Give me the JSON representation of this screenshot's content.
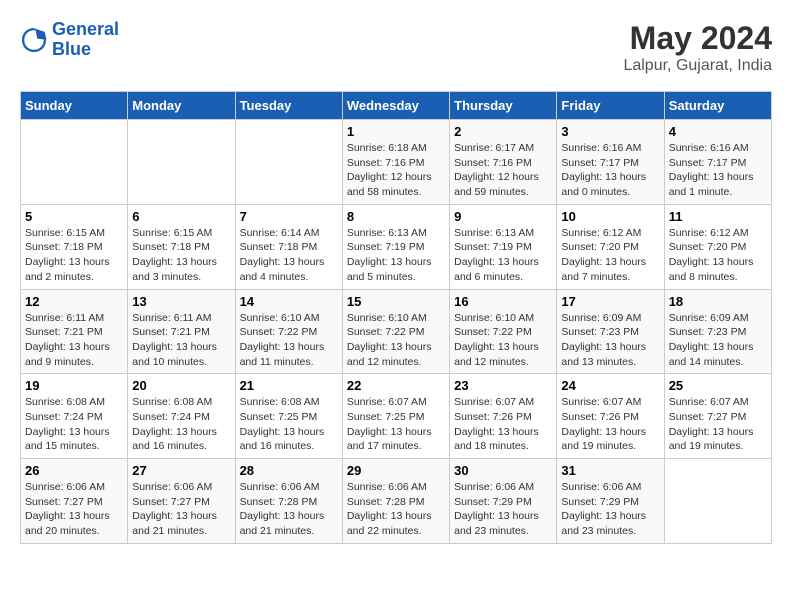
{
  "header": {
    "logo_line1": "General",
    "logo_line2": "Blue",
    "month_year": "May 2024",
    "location": "Lalpur, Gujarat, India"
  },
  "days_of_week": [
    "Sunday",
    "Monday",
    "Tuesday",
    "Wednesday",
    "Thursday",
    "Friday",
    "Saturday"
  ],
  "weeks": [
    [
      {
        "day": "",
        "info": ""
      },
      {
        "day": "",
        "info": ""
      },
      {
        "day": "",
        "info": ""
      },
      {
        "day": "1",
        "info": "Sunrise: 6:18 AM\nSunset: 7:16 PM\nDaylight: 12 hours\nand 58 minutes."
      },
      {
        "day": "2",
        "info": "Sunrise: 6:17 AM\nSunset: 7:16 PM\nDaylight: 12 hours\nand 59 minutes."
      },
      {
        "day": "3",
        "info": "Sunrise: 6:16 AM\nSunset: 7:17 PM\nDaylight: 13 hours\nand 0 minutes."
      },
      {
        "day": "4",
        "info": "Sunrise: 6:16 AM\nSunset: 7:17 PM\nDaylight: 13 hours\nand 1 minute."
      }
    ],
    [
      {
        "day": "5",
        "info": "Sunrise: 6:15 AM\nSunset: 7:18 PM\nDaylight: 13 hours\nand 2 minutes."
      },
      {
        "day": "6",
        "info": "Sunrise: 6:15 AM\nSunset: 7:18 PM\nDaylight: 13 hours\nand 3 minutes."
      },
      {
        "day": "7",
        "info": "Sunrise: 6:14 AM\nSunset: 7:18 PM\nDaylight: 13 hours\nand 4 minutes."
      },
      {
        "day": "8",
        "info": "Sunrise: 6:13 AM\nSunset: 7:19 PM\nDaylight: 13 hours\nand 5 minutes."
      },
      {
        "day": "9",
        "info": "Sunrise: 6:13 AM\nSunset: 7:19 PM\nDaylight: 13 hours\nand 6 minutes."
      },
      {
        "day": "10",
        "info": "Sunrise: 6:12 AM\nSunset: 7:20 PM\nDaylight: 13 hours\nand 7 minutes."
      },
      {
        "day": "11",
        "info": "Sunrise: 6:12 AM\nSunset: 7:20 PM\nDaylight: 13 hours\nand 8 minutes."
      }
    ],
    [
      {
        "day": "12",
        "info": "Sunrise: 6:11 AM\nSunset: 7:21 PM\nDaylight: 13 hours\nand 9 minutes."
      },
      {
        "day": "13",
        "info": "Sunrise: 6:11 AM\nSunset: 7:21 PM\nDaylight: 13 hours\nand 10 minutes."
      },
      {
        "day": "14",
        "info": "Sunrise: 6:10 AM\nSunset: 7:22 PM\nDaylight: 13 hours\nand 11 minutes."
      },
      {
        "day": "15",
        "info": "Sunrise: 6:10 AM\nSunset: 7:22 PM\nDaylight: 13 hours\nand 12 minutes."
      },
      {
        "day": "16",
        "info": "Sunrise: 6:10 AM\nSunset: 7:22 PM\nDaylight: 13 hours\nand 12 minutes."
      },
      {
        "day": "17",
        "info": "Sunrise: 6:09 AM\nSunset: 7:23 PM\nDaylight: 13 hours\nand 13 minutes."
      },
      {
        "day": "18",
        "info": "Sunrise: 6:09 AM\nSunset: 7:23 PM\nDaylight: 13 hours\nand 14 minutes."
      }
    ],
    [
      {
        "day": "19",
        "info": "Sunrise: 6:08 AM\nSunset: 7:24 PM\nDaylight: 13 hours\nand 15 minutes."
      },
      {
        "day": "20",
        "info": "Sunrise: 6:08 AM\nSunset: 7:24 PM\nDaylight: 13 hours\nand 16 minutes."
      },
      {
        "day": "21",
        "info": "Sunrise: 6:08 AM\nSunset: 7:25 PM\nDaylight: 13 hours\nand 16 minutes."
      },
      {
        "day": "22",
        "info": "Sunrise: 6:07 AM\nSunset: 7:25 PM\nDaylight: 13 hours\nand 17 minutes."
      },
      {
        "day": "23",
        "info": "Sunrise: 6:07 AM\nSunset: 7:26 PM\nDaylight: 13 hours\nand 18 minutes."
      },
      {
        "day": "24",
        "info": "Sunrise: 6:07 AM\nSunset: 7:26 PM\nDaylight: 13 hours\nand 19 minutes."
      },
      {
        "day": "25",
        "info": "Sunrise: 6:07 AM\nSunset: 7:27 PM\nDaylight: 13 hours\nand 19 minutes."
      }
    ],
    [
      {
        "day": "26",
        "info": "Sunrise: 6:06 AM\nSunset: 7:27 PM\nDaylight: 13 hours\nand 20 minutes."
      },
      {
        "day": "27",
        "info": "Sunrise: 6:06 AM\nSunset: 7:27 PM\nDaylight: 13 hours\nand 21 minutes."
      },
      {
        "day": "28",
        "info": "Sunrise: 6:06 AM\nSunset: 7:28 PM\nDaylight: 13 hours\nand 21 minutes."
      },
      {
        "day": "29",
        "info": "Sunrise: 6:06 AM\nSunset: 7:28 PM\nDaylight: 13 hours\nand 22 minutes."
      },
      {
        "day": "30",
        "info": "Sunrise: 6:06 AM\nSunset: 7:29 PM\nDaylight: 13 hours\nand 23 minutes."
      },
      {
        "day": "31",
        "info": "Sunrise: 6:06 AM\nSunset: 7:29 PM\nDaylight: 13 hours\nand 23 minutes."
      },
      {
        "day": "",
        "info": ""
      }
    ]
  ]
}
